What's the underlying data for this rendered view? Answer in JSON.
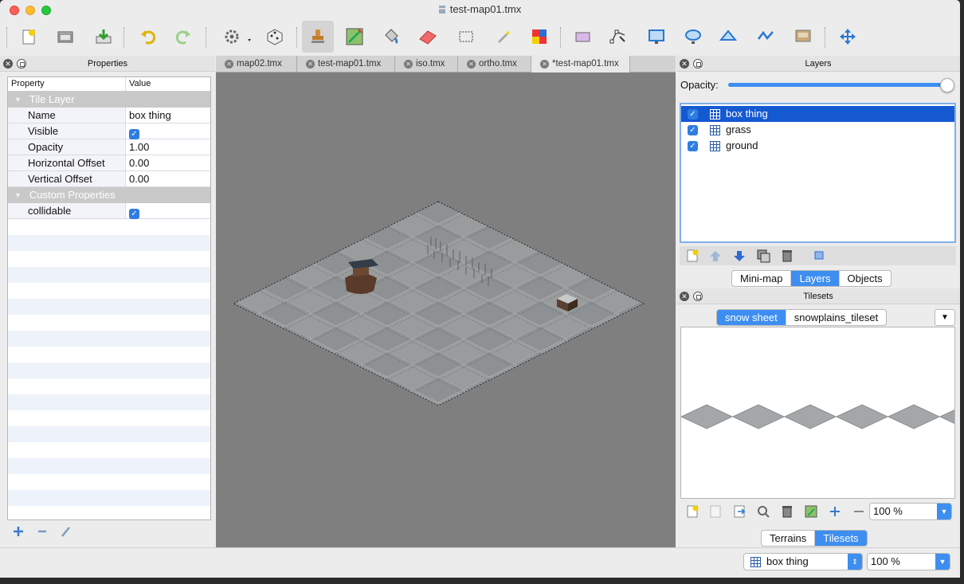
{
  "window": {
    "title": "test-map01.tmx"
  },
  "toolbar": {
    "icons": [
      "new-map-icon",
      "open-icon",
      "save-icon",
      "undo-icon",
      "redo-icon",
      "commands-icon",
      "random-icon",
      "stamp-brush-icon",
      "terrain-brush-icon",
      "bucket-fill-icon",
      "eraser-icon",
      "rect-select-icon",
      "magic-wand-icon",
      "select-same-tile-icon",
      "select-objects-icon",
      "edit-polygons-icon",
      "insert-rectangle-icon",
      "insert-ellipse-icon",
      "insert-polygon-icon",
      "insert-polyline-icon",
      "insert-tile-icon",
      "move-icon"
    ]
  },
  "properties_panel": {
    "title": "Properties",
    "col_property": "Property",
    "col_value": "Value",
    "group1": "Tile Layer",
    "rows": [
      {
        "name": "Name",
        "value": "box thing"
      },
      {
        "name": "Visible",
        "value": ""
      },
      {
        "name": "Opacity",
        "value": "1.00"
      },
      {
        "name": "Horizontal Offset",
        "value": "0.00"
      },
      {
        "name": "Vertical Offset",
        "value": "0.00"
      }
    ],
    "group2": "Custom Properties",
    "custom_rows": [
      {
        "name": "collidable",
        "value": ""
      }
    ]
  },
  "doc_tabs": [
    "map02.tmx",
    "test-map01.tmx",
    "iso.tmx",
    "ortho.tmx",
    "*test-map01.tmx"
  ],
  "active_tab": "*test-map01.tmx",
  "layers_panel": {
    "title": "Layers",
    "opacity_label": "Opacity:",
    "opacity_value": 1.0,
    "layers": [
      {
        "name": "box thing",
        "visible": true,
        "selected": true
      },
      {
        "name": "grass",
        "visible": true,
        "selected": false
      },
      {
        "name": "ground",
        "visible": true,
        "selected": false
      }
    ],
    "tabs": [
      "Mini-map",
      "Layers",
      "Objects"
    ],
    "active_tab": "Layers"
  },
  "tilesets_panel": {
    "title": "Tilesets",
    "tabs": [
      "snow sheet",
      "snowplains_tileset"
    ],
    "active_tab": "snow sheet",
    "zoom": "100 %",
    "bottom_tabs": [
      "Terrains",
      "Tilesets"
    ],
    "bottom_active": "Tilesets"
  },
  "statusbar": {
    "layer_select": "box thing",
    "zoom": "100 %"
  },
  "colors": {
    "accent": "#3d8ef0",
    "selection": "#1559d1",
    "canvas": "#7f7f7f"
  }
}
